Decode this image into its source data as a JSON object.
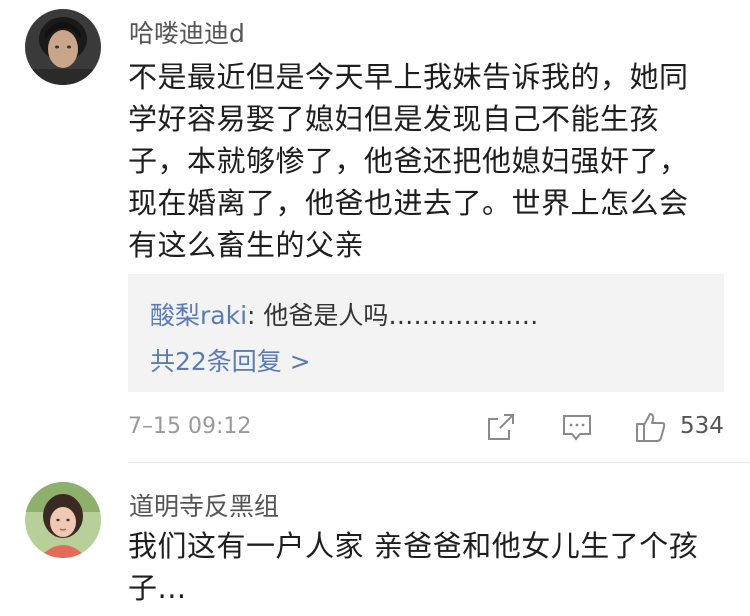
{
  "comments": [
    {
      "username": "哈喽迪迪d",
      "text_lines": [
        "不是最近但是今天早上我妹告诉我的，她同",
        "学好容易娶了媳妇但是发现自己不能生孩",
        "子，本就够惨了，他爸还把他媳妇强奸了，",
        "现在婚离了，他爸也进去了。世界上怎么会",
        "有这么畜生的父亲"
      ],
      "reply": {
        "user": "酸梨raki",
        "separator": ": ",
        "text": "他爸是人吗………………",
        "count_label": "共22条回复 >"
      },
      "timestamp": "7–15 09:12",
      "actions": {
        "share_icon": "share-icon",
        "comment_icon": "comment-icon",
        "like_icon": "thumbs-up-icon",
        "like_count": "534"
      }
    },
    {
      "username": "道明寺反黑组",
      "text_lines": [
        "我们这有一户人家 亲爸爸和他女儿生了个孩",
        "子..."
      ]
    }
  ],
  "colors": {
    "link_blue": "#5a7bb5",
    "reply_bg": "#f3f3f3",
    "meta_gray": "#9a9a9a"
  }
}
